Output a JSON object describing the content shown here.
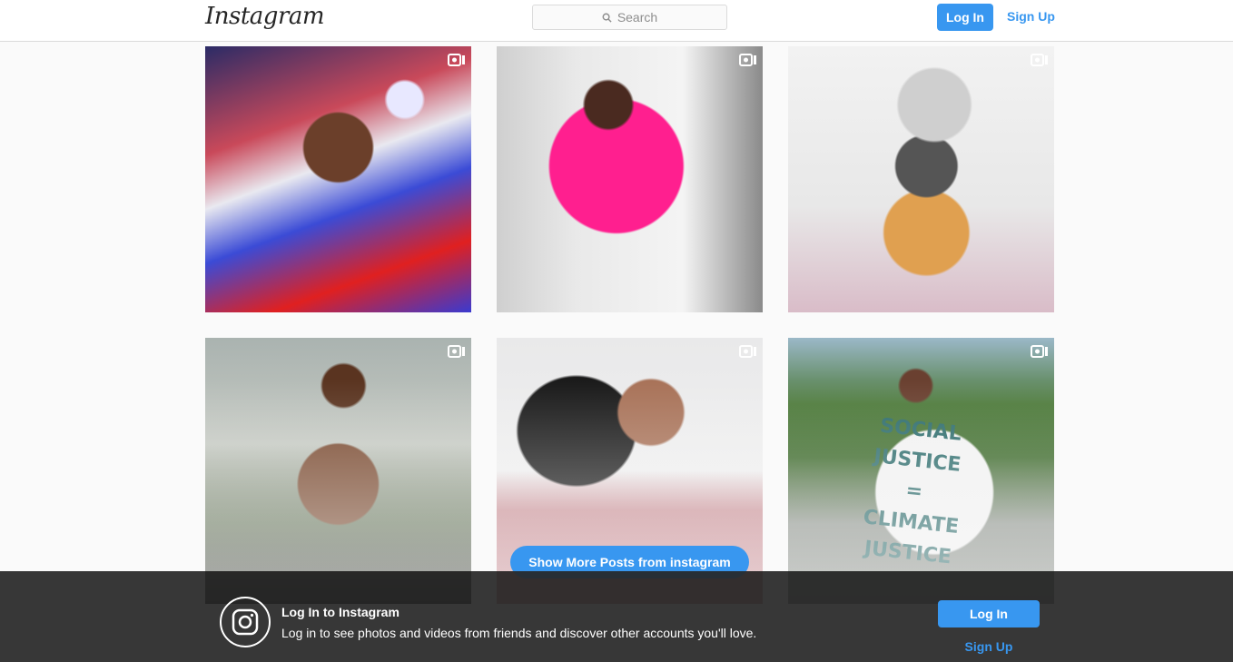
{
  "header": {
    "logo_text": "Instagram",
    "search_placeholder": "Search",
    "login_label": "Log In",
    "signup_label": "Sign Up"
  },
  "posts": [
    {
      "type": "video"
    },
    {
      "type": "video"
    },
    {
      "type": "video"
    },
    {
      "type": "video"
    },
    {
      "type": "video"
    },
    {
      "type": "video",
      "sign_lines": [
        "SOCIAL JUSTICE",
        "=",
        "CLIMATE JUSTICE"
      ]
    }
  ],
  "show_more_label": "Show More Posts from instagram",
  "login_banner": {
    "title": "Log In to Instagram",
    "description": "Log in to see photos and videos from friends and discover other accounts you'll love.",
    "login_label": "Log In",
    "signup_label": "Sign Up"
  },
  "colors": {
    "accent": "#3897f0",
    "banner_bg": "#262626"
  }
}
